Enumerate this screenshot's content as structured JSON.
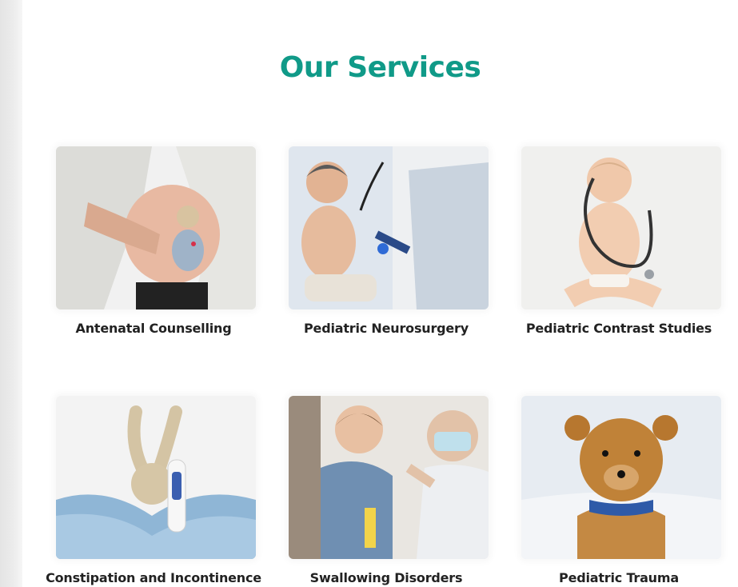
{
  "section": {
    "title": "Our Services"
  },
  "services": [
    {
      "label": "Antenatal Counselling",
      "image": "pregnant-woman-teddy-bear-photo"
    },
    {
      "label": "Pediatric Neurosurgery",
      "image": "doctor-examining-baby-photo"
    },
    {
      "label": "Pediatric Contrast Studies",
      "image": "baby-with-stethoscope-photo"
    },
    {
      "label": "Constipation and Incontinence",
      "image": "toy-bunny-thermometer-photo"
    },
    {
      "label": "Swallowing Disorders",
      "image": "doctor-examining-child-throat-photo"
    },
    {
      "label": "Pediatric Trauma",
      "image": "teddy-bear-in-bed-photo"
    }
  ],
  "colors": {
    "accent": "#109a88",
    "label_text": "#222222"
  }
}
